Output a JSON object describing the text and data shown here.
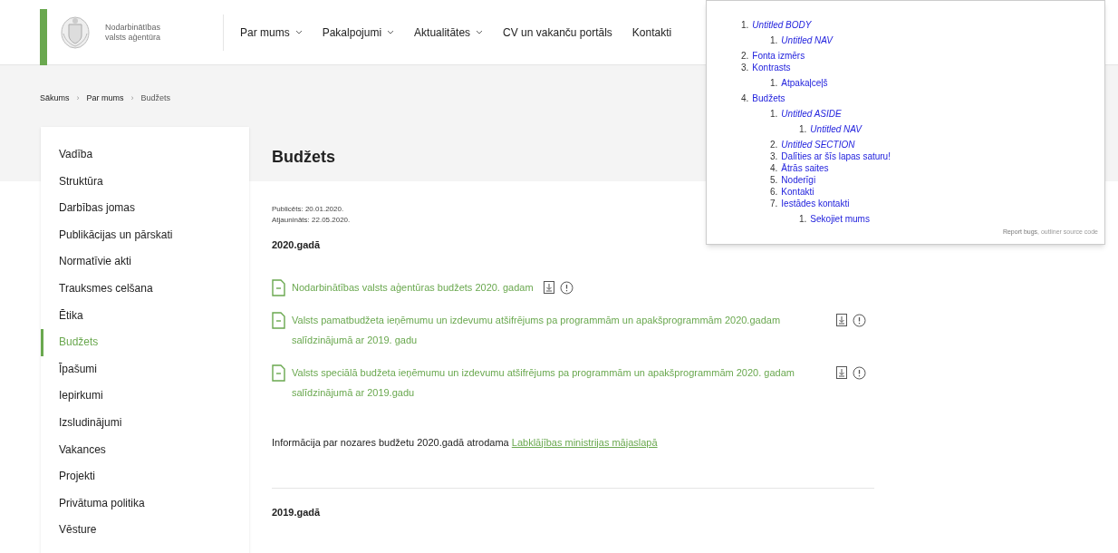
{
  "header": {
    "logo_text": [
      "Nodarbinātības",
      "valsts aģentūra"
    ],
    "nav": [
      {
        "label": "Par mums",
        "dropdown": true
      },
      {
        "label": "Pakalpojumi",
        "dropdown": true
      },
      {
        "label": "Aktualitātes",
        "dropdown": true
      },
      {
        "label": "CV un vakanču portāls",
        "dropdown": false
      },
      {
        "label": "Kontakti",
        "dropdown": false
      }
    ]
  },
  "breadcrumb": [
    "Sākums",
    "Par mums",
    "Budžets"
  ],
  "breadcrumb_separator": "›",
  "sidebar": {
    "items": [
      {
        "label": "Vadība",
        "selected": false
      },
      {
        "label": "Struktūra",
        "selected": false
      },
      {
        "label": "Darbības jomas",
        "selected": false
      },
      {
        "label": "Publikācijas un pārskati",
        "selected": false
      },
      {
        "label": "Normatīvie akti",
        "selected": false
      },
      {
        "label": "Trauksmes celšana",
        "selected": false
      },
      {
        "label": "Ētika",
        "selected": false
      },
      {
        "label": "Budžets",
        "selected": true
      },
      {
        "label": "Īpašumi",
        "selected": false
      },
      {
        "label": "Iepirkumi",
        "selected": false
      },
      {
        "label": "Izsludinājumi",
        "selected": false
      },
      {
        "label": "Vakances",
        "selected": false
      },
      {
        "label": "Projekti",
        "selected": false
      },
      {
        "label": "Privātuma politika",
        "selected": false
      },
      {
        "label": "Vēsture",
        "selected": false
      }
    ]
  },
  "content": {
    "title": "Budžets",
    "published": "Publicēts: 20.01.2020.",
    "updated": "Atjaunināts: 22.05.2020.",
    "sections": [
      {
        "heading": "2020.gadā",
        "documents": [
          {
            "title": "Nodarbinātības valsts aģentūras budžets 2020. gadam"
          },
          {
            "title": "Valsts pamatbudžeta ieņēmumu un izdevumu atšifrējums pa programmām un apakšprogrammām 2020.gadam salīdzinājumā ar 2019. gadu"
          },
          {
            "title": "Valsts speciālā budžeta ieņēmumu un izdevumu atšifrējums pa programmām un apakšprogrammām 2020. gadam salīdzinājumā ar 2019.gadu"
          }
        ],
        "note": "Informācija par nozares budžetu 2020.gadā atrodama",
        "note_link": "Labklājības ministrijas mājaslapā"
      },
      {
        "heading": "2019.gadā"
      }
    ]
  },
  "outline": {
    "items": [
      {
        "number": "1.",
        "label": "Untitled BODY",
        "kind": "untitled",
        "children": [
          {
            "number": "1.",
            "label": "Untitled NAV",
            "kind": "untitled"
          }
        ]
      },
      {
        "number": "2.",
        "label": "Fonta izmērs",
        "kind": "heading"
      },
      {
        "number": "3.",
        "label": "Kontrasts",
        "kind": "heading",
        "children": [
          {
            "number": "1.",
            "label": "Atpakaļceļš",
            "kind": "heading"
          }
        ]
      },
      {
        "number": "4.",
        "label": "Budžets",
        "kind": "heading",
        "children": [
          {
            "number": "1.",
            "label": "Untitled ASIDE",
            "kind": "untitled",
            "children": [
              {
                "number": "1.",
                "label": "Untitled NAV",
                "kind": "untitled"
              }
            ]
          },
          {
            "number": "2.",
            "label": "Untitled SECTION",
            "kind": "untitled"
          },
          {
            "number": "3.",
            "label": "Dalīties ar šīs lapas saturu!",
            "kind": "heading"
          },
          {
            "number": "4.",
            "label": "Ātrās saites",
            "kind": "heading"
          },
          {
            "number": "5.",
            "label": "Noderīgi",
            "kind": "heading"
          },
          {
            "number": "6.",
            "label": "Kontakti",
            "kind": "heading"
          },
          {
            "number": "7.",
            "label": "Iestādes kontakti",
            "kind": "heading",
            "children": [
              {
                "number": "1.",
                "label": "Sekojiet mums",
                "kind": "heading"
              }
            ]
          }
        ]
      }
    ],
    "footer_link": "Report bugs",
    "footer_text": ", outliner source code"
  }
}
